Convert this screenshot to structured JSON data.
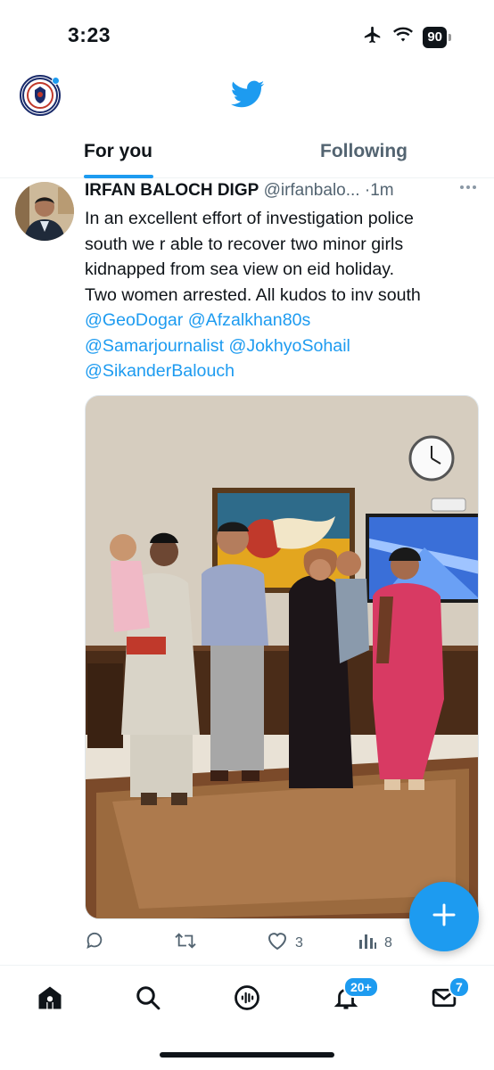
{
  "status_bar": {
    "time": "3:23",
    "battery": "90",
    "icons": [
      "airplane-icon",
      "wifi-icon",
      "battery-icon"
    ]
  },
  "header": {
    "logo_icon": "twitter-bird-icon",
    "tabs": [
      {
        "label": "For you",
        "active": true
      },
      {
        "label": "Following",
        "active": false
      }
    ]
  },
  "tweet": {
    "author_name": "IRFAN BALOCH DIGP",
    "author_handle": "@irfanbalo...",
    "separator": "·",
    "time": "1m",
    "text_lines": [
      "In an excellent effort of investigation police",
      "south we r able to recover two minor girls",
      "kidnapped from sea view on eid holiday.",
      "Two women arrested. All kudos to inv south"
    ],
    "mentions": {
      "geodogar": "@GeoDogar",
      "afzalkhan": "@Afzalkhan80s",
      "samar": "@Samarjournalist",
      "jokhyo": "@JokhyoSohail",
      "sikander": "@SikanderBalouch"
    },
    "actions": {
      "reply_count": "",
      "retweet_count": "",
      "like_count": "3",
      "views_count": "8"
    }
  },
  "bottom_nav": {
    "items": [
      "home-icon",
      "search-icon",
      "spaces-icon",
      "notifications-icon",
      "messages-icon"
    ],
    "notifications_badge": "20+",
    "messages_badge": "7"
  },
  "colors": {
    "accent": "#1d9bf0",
    "text_primary": "#0f1419",
    "text_secondary": "#536471"
  }
}
